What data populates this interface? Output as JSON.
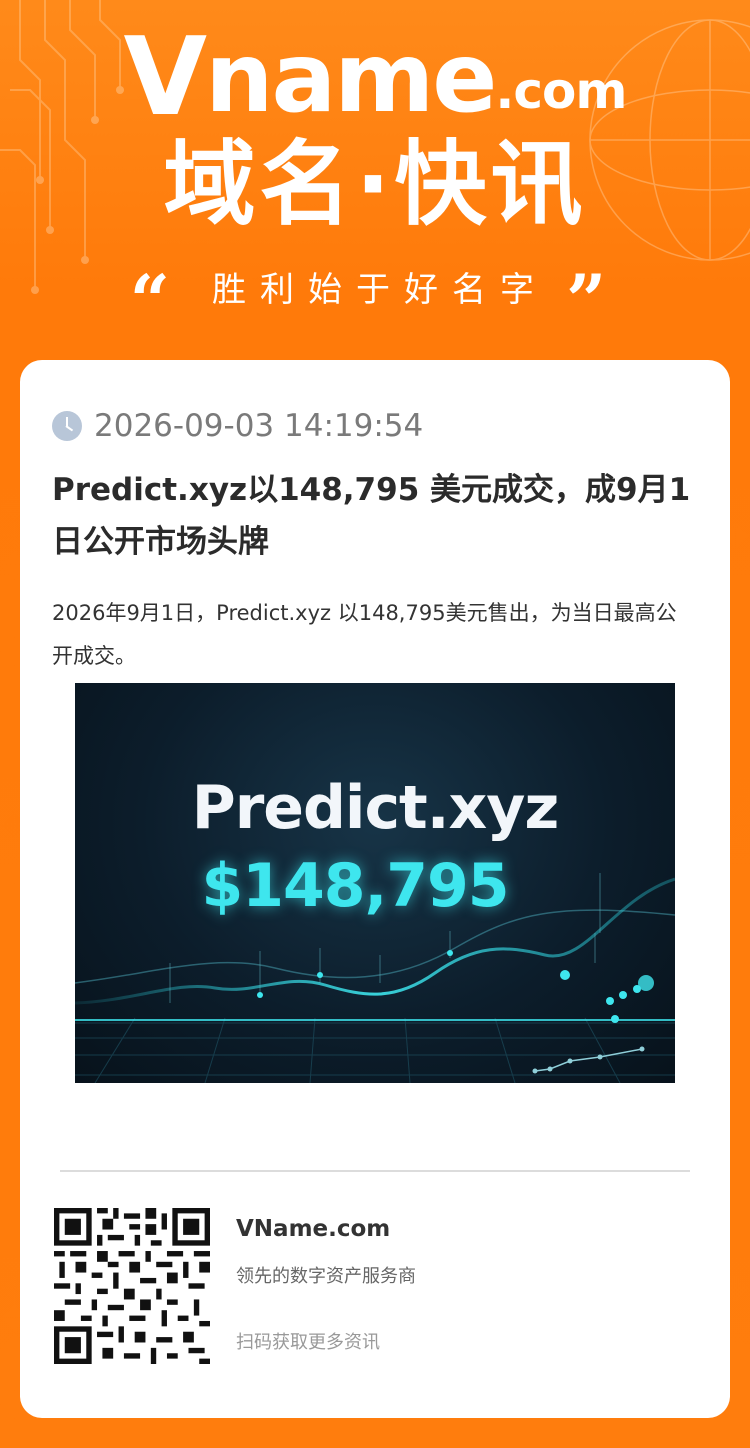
{
  "header": {
    "brand_v": "V",
    "brand_name": "name",
    "brand_com": ".com",
    "title": "域名·快讯",
    "slogan": "胜利始于好名字",
    "quote_open": "“",
    "quote_close": "”"
  },
  "article": {
    "timestamp": "2026-09-03 14:19:54",
    "title": "Predict.xyz以148,795 美元成交，成9月1日公开市场头牌",
    "summary": "2026年9月1日，Predict.xyz 以148,795美元售出，为当日最高公开成交。",
    "hero": {
      "domain": "Predict.xyz",
      "price": "$148,795"
    }
  },
  "footer": {
    "brand": "VName.com",
    "tagline": "领先的数字资产服务商",
    "cta": "扫码获取更多资讯"
  },
  "icons": {
    "clock": "clock-icon",
    "qr": "qr-code"
  },
  "colors": {
    "brand_orange": "#ff7d0d",
    "accent_cyan": "#3ee6ee"
  }
}
